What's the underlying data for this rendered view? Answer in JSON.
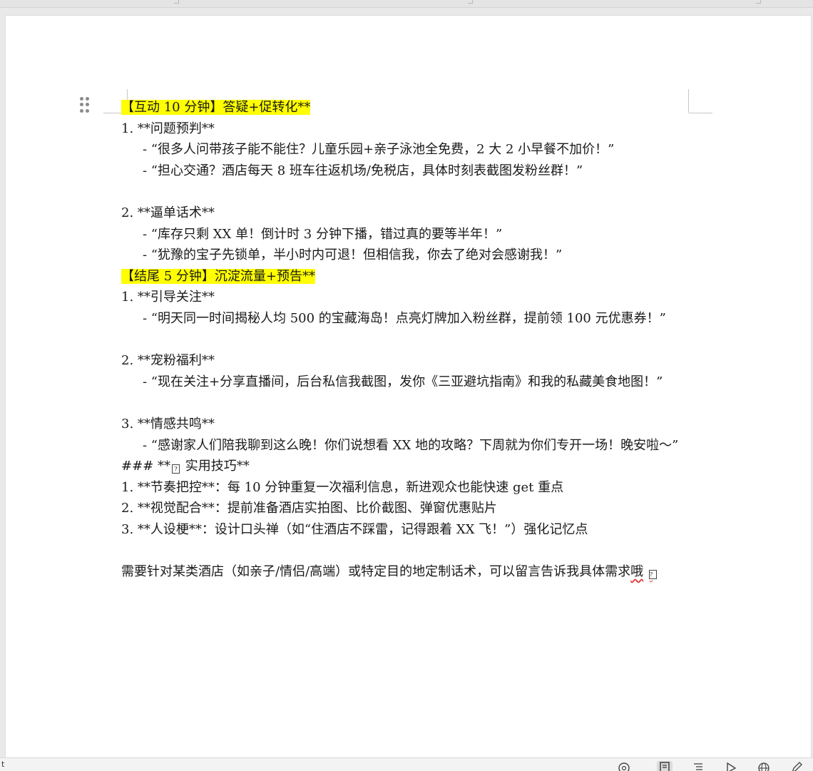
{
  "doc": {
    "lines": [
      {
        "text": "【互动 10 分钟】答疑+促转化**",
        "highlight": true
      },
      {
        "text": "1. **问题预判**"
      },
      {
        "text": "- “很多人问带孩子能不能住？儿童乐园+亲子泳池全免费，2 大 2 小早餐不加价！”",
        "indent": true
      },
      {
        "text": "- “担心交通？酒店每天 8 班车往返机场/免税店，具体时刻表截图发粉丝群！”",
        "indent": true
      },
      {
        "text": ""
      },
      {
        "text": "2. **逼单话术**"
      },
      {
        "text": "- “库存只剩 XX 单！倒计时 3 分钟下播，错过真的要等半年！”",
        "indent": true
      },
      {
        "text": "- “犹豫的宝子先锁单，半小时内可退！但相信我，你去了绝对会感谢我！”",
        "indent": true
      },
      {
        "text": "【结尾 5 分钟】沉淀流量+预告**",
        "highlight": true
      },
      {
        "text": "1. **引导关注**"
      },
      {
        "text": "- “明天同一时间揭秘人均 500 的宝藏海岛！点亮灯牌加入粉丝群，提前领 100 元优惠券！”",
        "indent": true,
        "wrap": true
      },
      {
        "text": ""
      },
      {
        "text": "2. **宠粉福利**"
      },
      {
        "text": "- “现在关注+分享直播间，后台私信我截图，发你《三亚避坑指南》和我的私藏美食地图！”",
        "indent": true,
        "wrap": true
      },
      {
        "text": ""
      },
      {
        "text": "3. **情感共鸣**"
      },
      {
        "text": "- “感谢家人们陪我聊到这么晚！你们说想看 XX 地的攻略？下周就为你们专开一场！晚安啦～”",
        "indent": true,
        "wrap": true
      },
      {
        "text": "### **",
        "glyph_after": true,
        "tail": " 实用技巧**"
      },
      {
        "text": "1. **节奏把控**：每 10 分钟重复一次福利信息，新进观众也能快速 get 重点"
      },
      {
        "text": "2. **视觉配合**：提前准备酒店实拍图、比价截图、弹窗优惠贴片"
      },
      {
        "text": "3. **人设梗**：设计口头禅（如“住酒店不踩雷，记得跟着 XX 飞！”）强化记忆点"
      },
      {
        "text": ""
      },
      {
        "text": "需要针对某类酒店（如亲子/情侣/高端）或特定目的地定制话术，可以留言告诉我具体需求哦 ",
        "wrap": true,
        "glyph_after": true,
        "squiggle_word": "哦"
      }
    ]
  },
  "glyph": "?",
  "status": {
    "left": "t",
    "icons": [
      "focus-icon",
      "page-view-icon",
      "outline-view-icon",
      "play-icon",
      "web-view-icon",
      "edit-icon"
    ]
  },
  "colors": {
    "highlight": "#ffff00",
    "page": "#ffffff",
    "background": "#e9e9e9"
  }
}
